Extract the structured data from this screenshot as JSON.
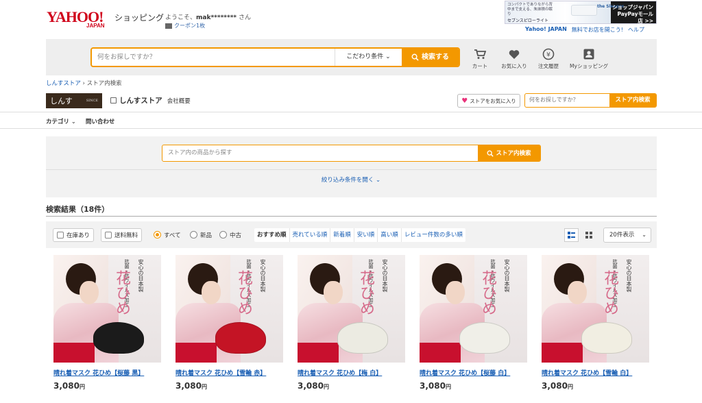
{
  "header": {
    "logo_text": "YAHOO!",
    "logo_sub": "JAPAN",
    "logo_shopping": "ショッピング",
    "greeting_prefix": "ようこそ、",
    "username": "mak********",
    "greeting_suffix": " さん",
    "coupon": "クーポン1枚",
    "toplinks": [
      "Yahoo! JAPAN",
      "無料でお店を開こう!",
      "ヘルプ"
    ]
  },
  "ad": {
    "line1": "コンパクトでありながら背中まで支える、朱抹積の眠り",
    "line2": "セブンスピローライト",
    "brand": "the Sleeper",
    "line3": "ショップジャパン PayPayモール店 >>"
  },
  "search": {
    "placeholder": "何をお探しですか？",
    "condition": "こだわり条件",
    "button": "検索する"
  },
  "nav": {
    "cart": "カート",
    "favorites": "お気に入り",
    "history": "注文履歴",
    "myshopping": "Myショッピング"
  },
  "breadcrumb": {
    "store": "しんすストア",
    "sep": "›",
    "current": "ストア内検索"
  },
  "store": {
    "logo_text": "しんす",
    "logo_small": "SINCE",
    "name": "しんすストア",
    "company": "会社概要",
    "fav_button": "ストアをお気に入り",
    "search_placeholder": "何をお探しですか？",
    "search_button": "ストア内検索"
  },
  "subnav": {
    "category": "カテゴリ",
    "contact": "問い合わせ"
  },
  "storebox": {
    "placeholder": "ストア内の商品から探す",
    "button": "ストア内検索",
    "refine": "絞り込み条件を開く"
  },
  "results": {
    "title": "検索結果（18件）"
  },
  "filters": {
    "instock": "在庫あり",
    "freeship": "送料無料",
    "all": "すべて",
    "new": "新品",
    "used": "中古",
    "sort": [
      "おすすめ順",
      "売れている順",
      "新着順",
      "安い順",
      "高い順",
      "レビュー件数の多い順"
    ],
    "perpage": "20件表示"
  },
  "products": [
    {
      "title": "晴れ着マスク 花ひめ【桜藤 黒】",
      "price": "3,080",
      "unit": "円",
      "mask_color": "#1b1b1b"
    },
    {
      "title": "晴れ着マスク 花ひめ【雪輪 赤】",
      "price": "3,080",
      "unit": "円",
      "mask_color": "#c41425"
    },
    {
      "title": "晴れ着マスク 花ひめ【梅 白】",
      "price": "3,080",
      "unit": "円",
      "mask_color": "#ecebe2"
    },
    {
      "title": "晴れ着マスク 花ひめ【桜藤 白】",
      "price": "3,080",
      "unit": "円",
      "mask_color": "#f0efe8"
    },
    {
      "title": "晴れ着マスク 花ひめ【雪輪 白】",
      "price": "3,080",
      "unit": "円",
      "mask_color": "#f1eee2"
    }
  ],
  "product_image_text": {
    "v1": "抗菌・抗ウイルス加工",
    "v2": "安心の日本製",
    "v3": "晴れ着マスク",
    "big": "花ひめ"
  },
  "colors": {
    "accent": "#f39800",
    "link": "#1a5fb4",
    "brand": "#d0021b"
  }
}
